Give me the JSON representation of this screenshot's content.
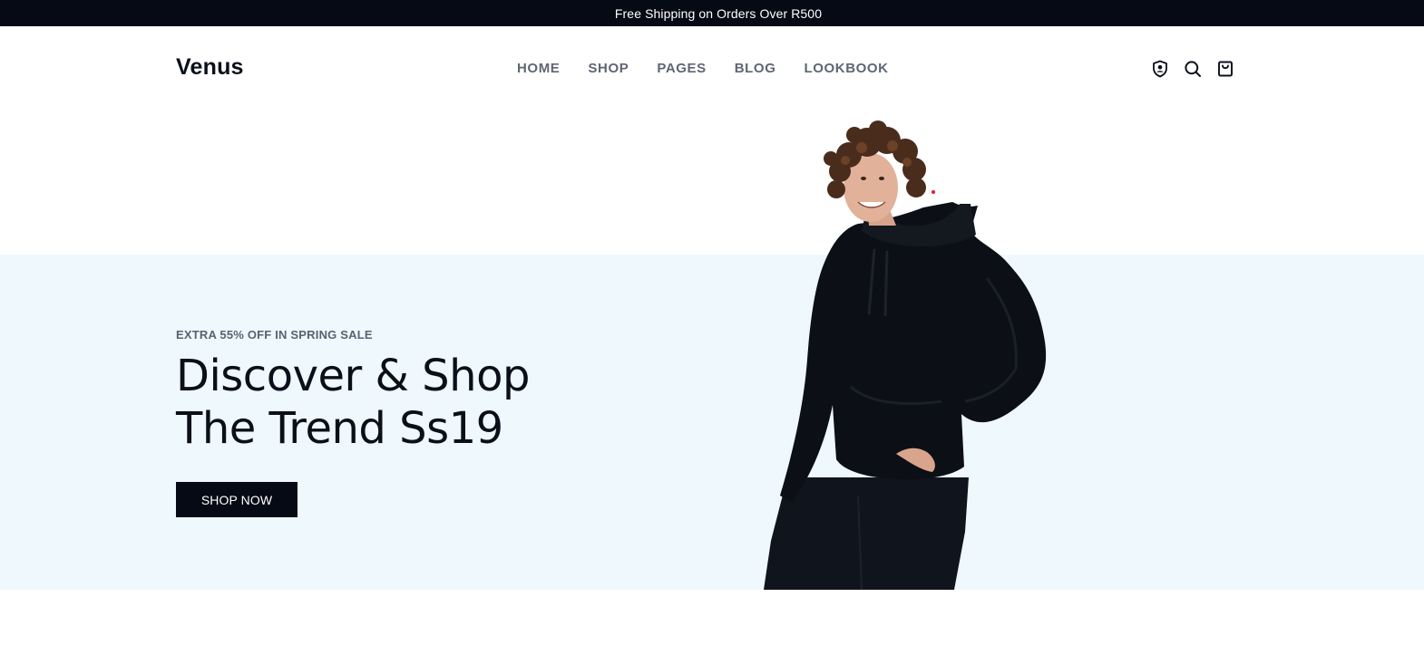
{
  "announcement": {
    "text": "Free Shipping on Orders Over R500"
  },
  "header": {
    "logo": "Venus",
    "nav": [
      {
        "label": "HOME"
      },
      {
        "label": "SHOP"
      },
      {
        "label": "PAGES"
      },
      {
        "label": "BLOG"
      },
      {
        "label": "LOOKBOOK"
      }
    ],
    "icons": [
      "account-shield-icon",
      "search-icon",
      "cart-icon"
    ]
  },
  "hero": {
    "subtitle": "EXTRA 55% OFF IN SPRING SALE",
    "title_line1": "Discover & Shop",
    "title_line2": "The Trend Ss19",
    "cta_label": "SHOP NOW",
    "image": "hooded-model-image"
  },
  "colors": {
    "dark": "#050a14",
    "nav_text": "#5f6673",
    "hero_bg": "#eff8fd",
    "white": "#ffffff"
  }
}
